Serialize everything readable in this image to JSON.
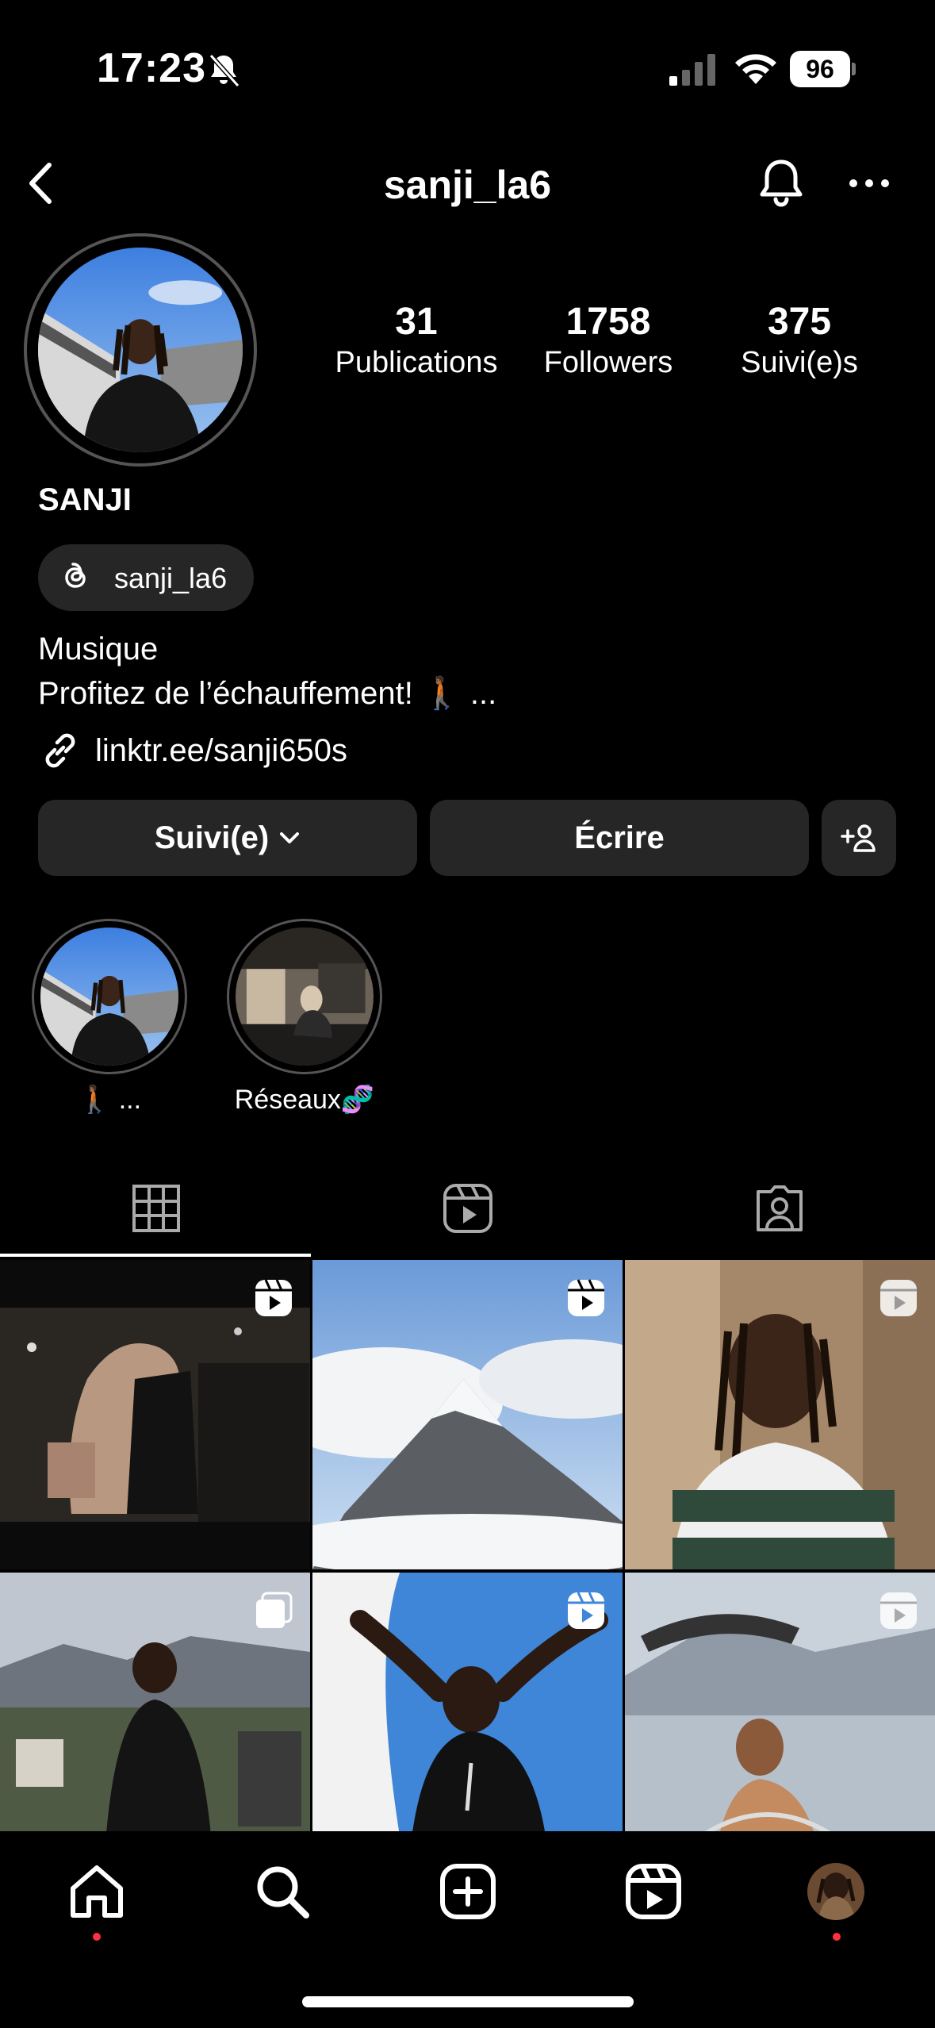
{
  "status_bar": {
    "time": "17:23",
    "battery": "96",
    "icons": [
      "bell-slash-icon",
      "cellular-signal-icon",
      "wifi-icon",
      "battery-icon"
    ]
  },
  "header": {
    "username": "sanji_la6",
    "icons": [
      "back-icon",
      "bell-icon",
      "more-icon"
    ]
  },
  "profile": {
    "stats": [
      {
        "value": "31",
        "label": "Publications"
      },
      {
        "value": "1758",
        "label": "Followers"
      },
      {
        "value": "375",
        "label": "Suivi(e)s"
      }
    ],
    "display_name": "SANJI",
    "threads_handle": "sanji_la6",
    "bio_line1": "Musique",
    "bio_line2": "Profitez de l’échauffement! 🚶🏾 ...",
    "link": "linktr.ee/sanji650s"
  },
  "actions": {
    "follow_label": "Suivi(e)",
    "message_label": "Écrire"
  },
  "highlights": [
    {
      "label": "🚶🏾 ..."
    },
    {
      "label": "Réseaux🧬"
    }
  ],
  "tabs": [
    "grid-icon",
    "reels-icon",
    "tagged-icon"
  ],
  "grid": [
    {
      "type": "reel"
    },
    {
      "type": "reel"
    },
    {
      "type": "reel"
    },
    {
      "type": "carousel"
    },
    {
      "type": "reel"
    },
    {
      "type": "reel"
    }
  ],
  "bottom_nav": [
    "home-icon",
    "search-icon",
    "create-icon",
    "reels-icon",
    "profile-avatar"
  ],
  "colors": {
    "background": "#000000",
    "button": "#262626",
    "notification_dot": "#ff3040",
    "text": "#ffffff"
  }
}
